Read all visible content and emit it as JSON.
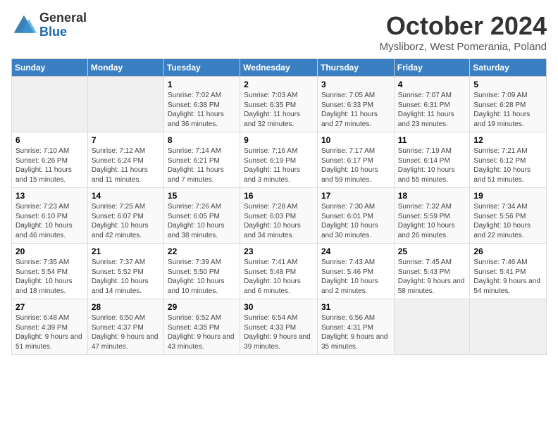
{
  "logo": {
    "general": "General",
    "blue": "Blue"
  },
  "header": {
    "month": "October 2024",
    "location": "Mysliborz, West Pomerania, Poland"
  },
  "days_of_week": [
    "Sunday",
    "Monday",
    "Tuesday",
    "Wednesday",
    "Thursday",
    "Friday",
    "Saturday"
  ],
  "weeks": [
    [
      {
        "day": "",
        "info": ""
      },
      {
        "day": "",
        "info": ""
      },
      {
        "day": "1",
        "info": "Sunrise: 7:02 AM\nSunset: 6:38 PM\nDaylight: 11 hours and 36 minutes."
      },
      {
        "day": "2",
        "info": "Sunrise: 7:03 AM\nSunset: 6:35 PM\nDaylight: 11 hours and 32 minutes."
      },
      {
        "day": "3",
        "info": "Sunrise: 7:05 AM\nSunset: 6:33 PM\nDaylight: 11 hours and 27 minutes."
      },
      {
        "day": "4",
        "info": "Sunrise: 7:07 AM\nSunset: 6:31 PM\nDaylight: 11 hours and 23 minutes."
      },
      {
        "day": "5",
        "info": "Sunrise: 7:09 AM\nSunset: 6:28 PM\nDaylight: 11 hours and 19 minutes."
      }
    ],
    [
      {
        "day": "6",
        "info": "Sunrise: 7:10 AM\nSunset: 6:26 PM\nDaylight: 11 hours and 15 minutes."
      },
      {
        "day": "7",
        "info": "Sunrise: 7:12 AM\nSunset: 6:24 PM\nDaylight: 11 hours and 11 minutes."
      },
      {
        "day": "8",
        "info": "Sunrise: 7:14 AM\nSunset: 6:21 PM\nDaylight: 11 hours and 7 minutes."
      },
      {
        "day": "9",
        "info": "Sunrise: 7:16 AM\nSunset: 6:19 PM\nDaylight: 11 hours and 3 minutes."
      },
      {
        "day": "10",
        "info": "Sunrise: 7:17 AM\nSunset: 6:17 PM\nDaylight: 10 hours and 59 minutes."
      },
      {
        "day": "11",
        "info": "Sunrise: 7:19 AM\nSunset: 6:14 PM\nDaylight: 10 hours and 55 minutes."
      },
      {
        "day": "12",
        "info": "Sunrise: 7:21 AM\nSunset: 6:12 PM\nDaylight: 10 hours and 51 minutes."
      }
    ],
    [
      {
        "day": "13",
        "info": "Sunrise: 7:23 AM\nSunset: 6:10 PM\nDaylight: 10 hours and 46 minutes."
      },
      {
        "day": "14",
        "info": "Sunrise: 7:25 AM\nSunset: 6:07 PM\nDaylight: 10 hours and 42 minutes."
      },
      {
        "day": "15",
        "info": "Sunrise: 7:26 AM\nSunset: 6:05 PM\nDaylight: 10 hours and 38 minutes."
      },
      {
        "day": "16",
        "info": "Sunrise: 7:28 AM\nSunset: 6:03 PM\nDaylight: 10 hours and 34 minutes."
      },
      {
        "day": "17",
        "info": "Sunrise: 7:30 AM\nSunset: 6:01 PM\nDaylight: 10 hours and 30 minutes."
      },
      {
        "day": "18",
        "info": "Sunrise: 7:32 AM\nSunset: 5:59 PM\nDaylight: 10 hours and 26 minutes."
      },
      {
        "day": "19",
        "info": "Sunrise: 7:34 AM\nSunset: 5:56 PM\nDaylight: 10 hours and 22 minutes."
      }
    ],
    [
      {
        "day": "20",
        "info": "Sunrise: 7:35 AM\nSunset: 5:54 PM\nDaylight: 10 hours and 18 minutes."
      },
      {
        "day": "21",
        "info": "Sunrise: 7:37 AM\nSunset: 5:52 PM\nDaylight: 10 hours and 14 minutes."
      },
      {
        "day": "22",
        "info": "Sunrise: 7:39 AM\nSunset: 5:50 PM\nDaylight: 10 hours and 10 minutes."
      },
      {
        "day": "23",
        "info": "Sunrise: 7:41 AM\nSunset: 5:48 PM\nDaylight: 10 hours and 6 minutes."
      },
      {
        "day": "24",
        "info": "Sunrise: 7:43 AM\nSunset: 5:46 PM\nDaylight: 10 hours and 2 minutes."
      },
      {
        "day": "25",
        "info": "Sunrise: 7:45 AM\nSunset: 5:43 PM\nDaylight: 9 hours and 58 minutes."
      },
      {
        "day": "26",
        "info": "Sunrise: 7:46 AM\nSunset: 5:41 PM\nDaylight: 9 hours and 54 minutes."
      }
    ],
    [
      {
        "day": "27",
        "info": "Sunrise: 6:48 AM\nSunset: 4:39 PM\nDaylight: 9 hours and 51 minutes."
      },
      {
        "day": "28",
        "info": "Sunrise: 6:50 AM\nSunset: 4:37 PM\nDaylight: 9 hours and 47 minutes."
      },
      {
        "day": "29",
        "info": "Sunrise: 6:52 AM\nSunset: 4:35 PM\nDaylight: 9 hours and 43 minutes."
      },
      {
        "day": "30",
        "info": "Sunrise: 6:54 AM\nSunset: 4:33 PM\nDaylight: 9 hours and 39 minutes."
      },
      {
        "day": "31",
        "info": "Sunrise: 6:56 AM\nSunset: 4:31 PM\nDaylight: 9 hours and 35 minutes."
      },
      {
        "day": "",
        "info": ""
      },
      {
        "day": "",
        "info": ""
      }
    ]
  ]
}
